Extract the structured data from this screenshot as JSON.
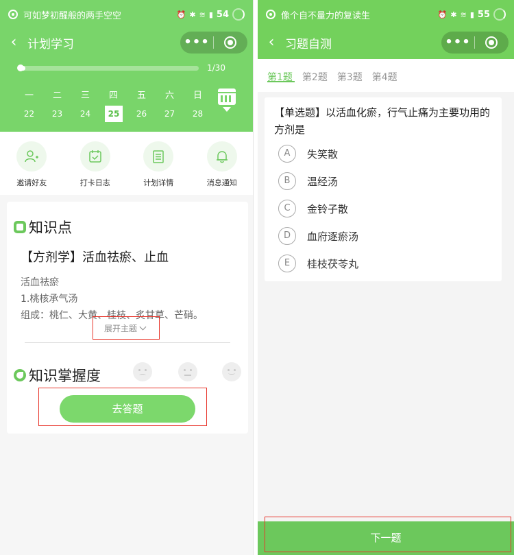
{
  "left": {
    "status": {
      "text": "可如梦初醒般的两手空空",
      "battery": "54"
    },
    "nav": {
      "title": "计划学习",
      "back": "‹",
      "menu_dots": "•••"
    },
    "progress": {
      "label": "1/30",
      "fraction": 0.033
    },
    "week": {
      "days": [
        "一",
        "二",
        "三",
        "四",
        "五",
        "六",
        "日"
      ],
      "dates": [
        "22",
        "23",
        "24",
        "25",
        "26",
        "27",
        "28"
      ],
      "selected_index": 3
    },
    "actions": [
      {
        "label": "邀请好友",
        "icon": "user-plus-icon",
        "glyph": "👤"
      },
      {
        "label": "打卡日志",
        "icon": "calendar-check-icon",
        "glyph": "☑"
      },
      {
        "label": "计划详情",
        "icon": "document-icon",
        "glyph": "☰"
      },
      {
        "label": "消息通知",
        "icon": "bell-icon",
        "glyph": "🔔"
      }
    ],
    "knowledge": {
      "title": "知识点",
      "topic": "【方剂学】活血祛瘀、止血",
      "lines": [
        "活血祛瘀",
        "1.桃核承气汤",
        "组成：桃仁、大黄、桂枝、炙甘草、芒硝。"
      ],
      "expand": "展开主题"
    },
    "mastery": {
      "title": "知识掌握度",
      "button": "去答题"
    }
  },
  "right": {
    "status": {
      "text": "像个自不量力的复读生",
      "battery": "55"
    },
    "nav": {
      "title": "习题自测",
      "back": "‹",
      "menu_dots": "•••"
    },
    "tabs": [
      "第1题",
      "第2题",
      "第3题",
      "第4题"
    ],
    "active_tab": 0,
    "question": "【单选题】以活血化瘀，行气止痛为主要功用的方剂是",
    "options": [
      {
        "letter": "A",
        "text": "失笑散"
      },
      {
        "letter": "B",
        "text": "温经汤"
      },
      {
        "letter": "C",
        "text": "金铃子散"
      },
      {
        "letter": "D",
        "text": "血府逐瘀汤"
      },
      {
        "letter": "E",
        "text": "桂枝茯苓丸"
      }
    ],
    "next": "下一题"
  },
  "colors": {
    "green_light": "#79d56a",
    "green_right": "#73d15c",
    "accent": "#6cc85c",
    "annotation_red": "#e8352b"
  }
}
